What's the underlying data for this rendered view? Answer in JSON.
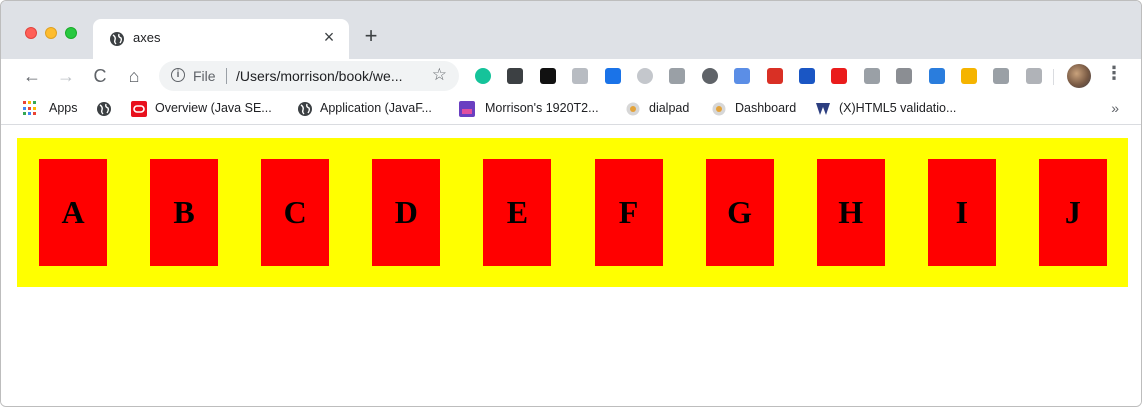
{
  "browser": {
    "tab": {
      "title": "axes",
      "close_symbol": "×"
    },
    "new_tab_symbol": "+",
    "nav": {
      "back": "←",
      "forward": "→",
      "reload": "C",
      "home": "⌂"
    },
    "omnibox": {
      "info_symbol": "i",
      "scheme": "File",
      "url": "/Users/morrison/book/we...",
      "star_symbol": "☆"
    },
    "extensions": [
      {
        "name": "grammarly-icon",
        "color": "#15c39a"
      },
      {
        "name": "extension-dark-icon",
        "color": "#3c4043"
      },
      {
        "name": "vimeo-icon",
        "color": "#111111"
      },
      {
        "name": "shield-icon",
        "color": "#b8bcc2"
      },
      {
        "name": "key-icon",
        "color": "#1a73e8"
      },
      {
        "name": "gray-circle-icon",
        "color": "#c4c7cc"
      },
      {
        "name": "es-icon",
        "color": "#9aa0a6"
      },
      {
        "name": "dark-circle-icon",
        "color": "#5f6368"
      },
      {
        "name": "brush-icon",
        "color": "#5b8ee6"
      },
      {
        "name": "play-icon",
        "color": "#d93025"
      },
      {
        "name": "message-icon",
        "color": "#1a56c4"
      },
      {
        "name": "opera-icon",
        "color": "#ea1c1c"
      },
      {
        "name": "gray-square-icon",
        "color": "#9aa0a6"
      },
      {
        "name": "n-icon",
        "color": "#8b8e93"
      },
      {
        "name": "s-icon",
        "color": "#2a7ddd"
      },
      {
        "name": "yellow-dots-icon",
        "color": "#f5b400"
      },
      {
        "name": "drive-icon",
        "color": "#9aa0a6"
      },
      {
        "name": "gray-triangle-icon",
        "color": "#b0b3b8"
      }
    ],
    "menu_symbol": "⋮"
  },
  "bookmarks": {
    "items": [
      {
        "label": "Apps"
      },
      {
        "label": ""
      },
      {
        "label": "Overview (Java SE..."
      },
      {
        "label": "Application (JavaF..."
      },
      {
        "label": "Morrison's 1920T2..."
      },
      {
        "label": "dialpad"
      },
      {
        "label": "Dashboard"
      },
      {
        "label": "(X)HTML5 validatio..."
      }
    ],
    "more_symbol": "»"
  },
  "page": {
    "banner_color": "#ffff00",
    "box_color": "#ff0000",
    "boxes": [
      "A",
      "B",
      "C",
      "D",
      "E",
      "F",
      "G",
      "H",
      "I",
      "J"
    ]
  }
}
